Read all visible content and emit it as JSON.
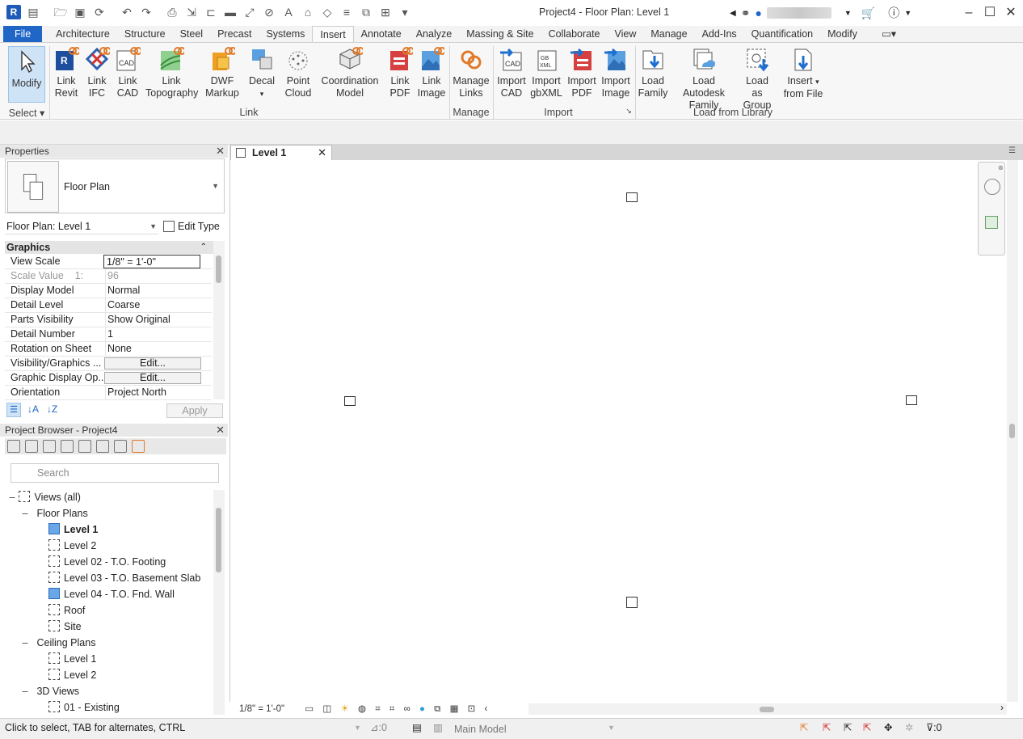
{
  "window": {
    "title": "Project4 - Floor Plan: Level 1",
    "app_logo": "R"
  },
  "ribbon_tabs": [
    {
      "label": "File"
    },
    {
      "label": "Architecture"
    },
    {
      "label": "Structure"
    },
    {
      "label": "Steel"
    },
    {
      "label": "Precast"
    },
    {
      "label": "Systems"
    },
    {
      "label": "Insert"
    },
    {
      "label": "Annotate"
    },
    {
      "label": "Analyze"
    },
    {
      "label": "Massing & Site"
    },
    {
      "label": "Collaborate"
    },
    {
      "label": "View"
    },
    {
      "label": "Manage"
    },
    {
      "label": "Add-Ins"
    },
    {
      "label": "Quantification"
    },
    {
      "label": "Modify"
    }
  ],
  "ribbon": {
    "modify": {
      "label": "Modify"
    },
    "select_label": "Select",
    "link_group": "Link",
    "manage_group": "Manage",
    "import_group": "Import",
    "load_group": "Load from Library",
    "buttons": {
      "link_revit": [
        "Link",
        "Revit"
      ],
      "link_ifc": [
        "Link",
        "IFC"
      ],
      "link_cad": [
        "Link",
        "CAD"
      ],
      "link_topo": [
        "Link",
        "Topography"
      ],
      "dwf": [
        "DWF",
        "Markup"
      ],
      "decal": [
        "Decal",
        ""
      ],
      "point_cloud": [
        "Point",
        "Cloud"
      ],
      "coord_model": [
        "Coordination",
        "Model"
      ],
      "link_pdf": [
        "Link",
        "PDF"
      ],
      "link_image": [
        "Link",
        "Image"
      ],
      "manage_links": [
        "Manage",
        "Links"
      ],
      "import_cad": [
        "Import",
        "CAD"
      ],
      "import_gbxml": [
        "Import",
        "gbXML"
      ],
      "import_pdf": [
        "Import",
        "PDF"
      ],
      "import_image": [
        "Import",
        "Image"
      ],
      "load_family": [
        "Load",
        "Family"
      ],
      "load_autodesk": [
        "Load Autodesk",
        "Family"
      ],
      "load_group": [
        "Load as",
        "Group"
      ],
      "insert_file": [
        "Insert",
        "from File"
      ]
    }
  },
  "properties": {
    "title": "Properties",
    "type_name": "Floor Plan",
    "selector": "Floor Plan: Level 1",
    "edit_type": "Edit Type",
    "section": "Graphics",
    "rows": [
      {
        "k": "View Scale",
        "v": "1/8\" = 1'-0\""
      },
      {
        "k": "Scale Value    1:",
        "v": "96"
      },
      {
        "k": "Display Model",
        "v": "Normal"
      },
      {
        "k": "Detail Level",
        "v": "Coarse"
      },
      {
        "k": "Parts Visibility",
        "v": "Show Original"
      },
      {
        "k": "Detail Number",
        "v": "1"
      },
      {
        "k": "Rotation on Sheet",
        "v": "None"
      },
      {
        "k": "Visibility/Graphics ...",
        "v": "Edit..."
      },
      {
        "k": "Graphic Display Op...",
        "v": "Edit..."
      },
      {
        "k": "Orientation",
        "v": "Project North"
      }
    ],
    "apply": "Apply"
  },
  "project_browser": {
    "title": "Project Browser - Project4",
    "search_placeholder": "Search",
    "tree": [
      {
        "label": "Views (all)"
      },
      {
        "label": "Floor Plans"
      },
      {
        "label": "Level 1"
      },
      {
        "label": "Level 2"
      },
      {
        "label": "Level 02 - T.O. Footing"
      },
      {
        "label": "Level 03 - T.O. Basement Slab"
      },
      {
        "label": "Level 04 - T.O. Fnd. Wall"
      },
      {
        "label": "Roof"
      },
      {
        "label": "Site"
      },
      {
        "label": "Ceiling Plans"
      },
      {
        "label": "Level 1"
      },
      {
        "label": "Level 2"
      },
      {
        "label": "3D Views"
      },
      {
        "label": "01 - Existing"
      }
    ]
  },
  "view": {
    "tab": "Level 1",
    "scale": "1/8\" = 1'-0\""
  },
  "status": {
    "text": "Click to select, TAB for alternates, CTRL",
    "count": ":0",
    "model": "Main Model",
    "filter": ":0"
  }
}
